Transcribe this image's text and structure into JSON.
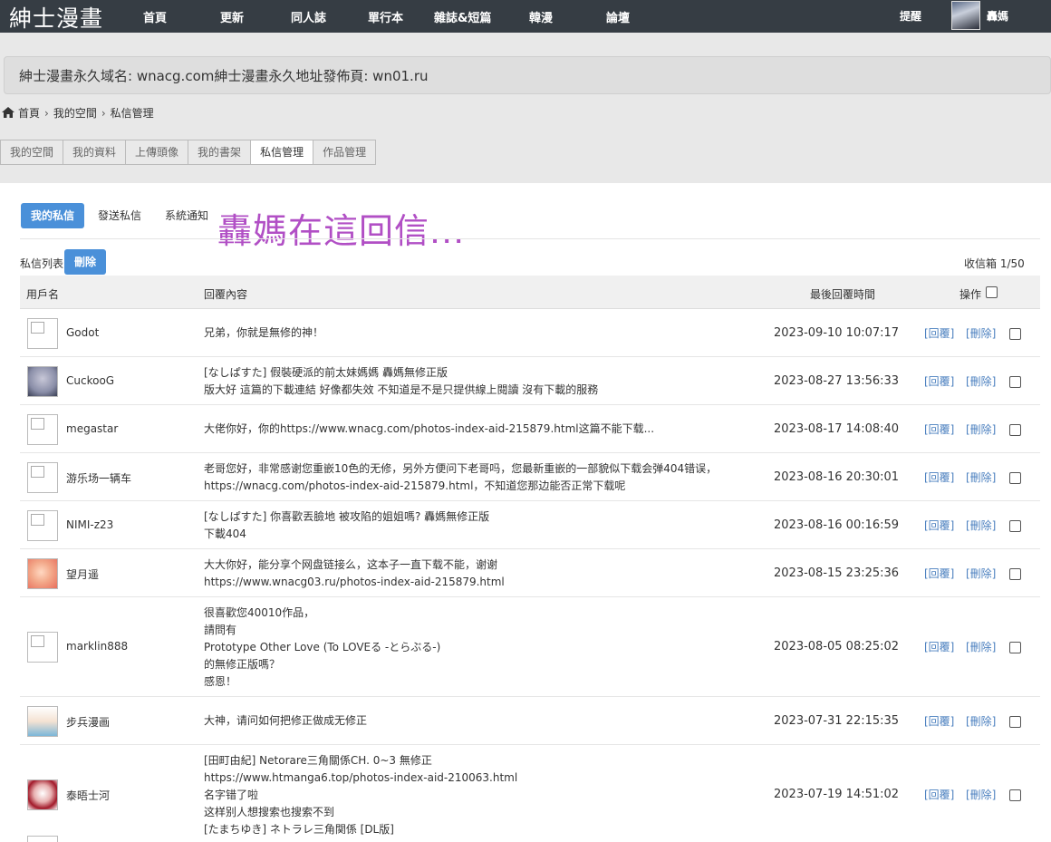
{
  "nav": {
    "logo": "紳士漫畫",
    "items": [
      "首頁",
      "更新",
      "同人誌",
      "單行本",
      "雜誌&短篇",
      "韓漫",
      "論壇"
    ],
    "remind": "提醒",
    "username": "轟媽"
  },
  "announcement": "紳士漫畫永久域名: wnacg.com紳士漫畫永久地址發佈頁: wn01.ru",
  "breadcrumb": [
    "首頁",
    "我的空間",
    "私信管理"
  ],
  "tabs": [
    "我的空間",
    "我的資料",
    "上傳頭像",
    "我的書架",
    "私信管理",
    "作品管理"
  ],
  "subtabs": [
    "我的私信",
    "發送私信",
    "系統通知"
  ],
  "scrawl": "轟媽在這回信...",
  "list": {
    "label": "私信列表",
    "delete": "刪除",
    "inbox": "收信箱 1/50"
  },
  "columns": {
    "user": "用戶名",
    "content": "回覆內容",
    "time": "最後回覆時間",
    "ops": "操作"
  },
  "rows": [
    {
      "user": "Godot",
      "lines": [
        "兄弟，你就是無修的神！"
      ],
      "time": "2023-09-10 10:07:17",
      "avatar": "broken"
    },
    {
      "user": "CuckooG",
      "lines": [
        "[なしぱすた] 假裝硬派的前太妹媽媽 轟媽無修正版",
        "版大好 這篇的下載連結 好像都失效 不知道是不是只提供線上閱讀 沒有下載的服務"
      ],
      "time": "2023-08-27 13:56:33",
      "avatar": "img1"
    },
    {
      "user": "megastar",
      "lines": [
        "大佬你好，你的https://www.wnacg.com/photos-index-aid-215879.html这篇不能下载..."
      ],
      "time": "2023-08-17 14:08:40",
      "avatar": "broken"
    },
    {
      "user": "游乐场一辆车",
      "lines": [
        "老哥您好，非常感谢您重嵌10色的无修，另外方便问下老哥吗，您最新重嵌的一部貌似下载会弹404错误，",
        "https://wnacg.com/photos-index-aid-215879.html，不知道您那边能否正常下载呢"
      ],
      "time": "2023-08-16 20:30:01",
      "avatar": "broken"
    },
    {
      "user": "NIMI-z23",
      "lines": [
        "[なしぱすた] 你喜歡丟臉地 被攻陷的姐姐嗎? 轟媽無修正版",
        "下載404"
      ],
      "time": "2023-08-16 00:16:59",
      "avatar": "broken"
    },
    {
      "user": "望月遥",
      "lines": [
        "大大你好，能分享个网盘链接么，这本子一直下载不能，谢谢",
        "https://www.wnacg03.ru/photos-index-aid-215879.html"
      ],
      "time": "2023-08-15 23:25:36",
      "avatar": "img2"
    },
    {
      "user": "marklin888",
      "lines": [
        "很喜歡您40010作品，",
        "請問有",
        "Prototype Other Love (To LOVEる -とらぶる-)",
        "的無修正版嗎？",
        "感恩！"
      ],
      "time": "2023-08-05 08:25:02",
      "avatar": "broken"
    },
    {
      "user": "步兵漫画",
      "lines": [
        "大神，请问如何把修正做成无修正"
      ],
      "time": "2023-07-31 22:15:35",
      "avatar": "img3"
    },
    {
      "user": "泰晤士河",
      "lines": [
        "[田町由紀] Netorare三角關係CH. 0~3 無修正",
        "https://www.htmanga6.top/photos-index-aid-210063.html",
        "名字错了啦",
        "这样别人想搜索也搜索不到",
        "[たまちゆき] ネトラレ三角関係 [DL版]"
      ],
      "time": "2023-07-19 14:51:02",
      "avatar": "img4"
    }
  ],
  "actions": {
    "reply": "[回覆]",
    "delete": "[刪除]"
  }
}
